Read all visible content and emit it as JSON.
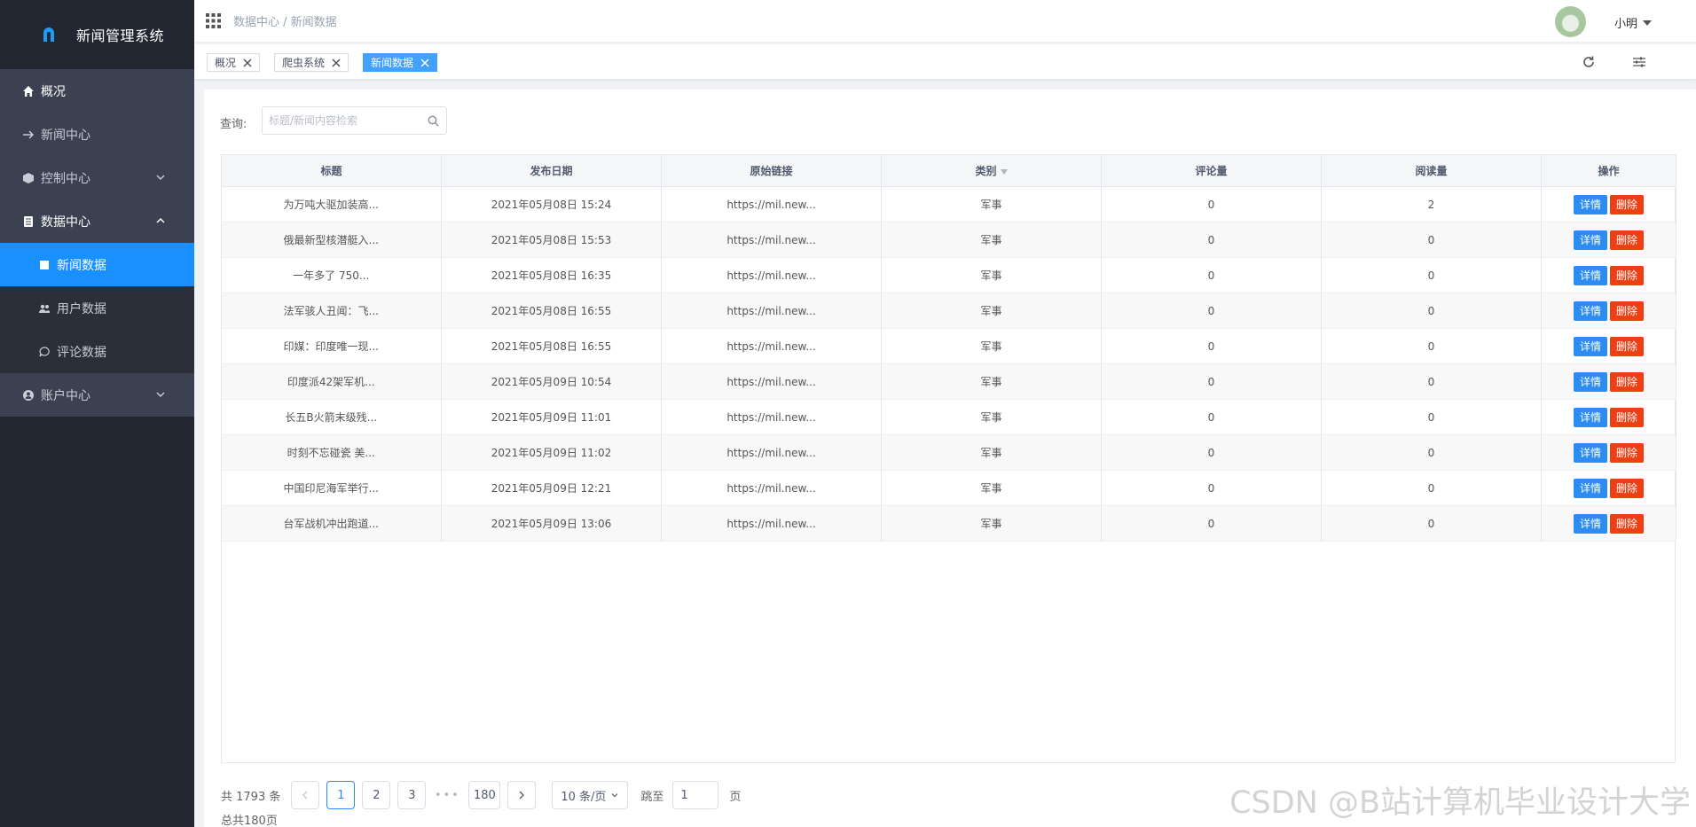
{
  "app": {
    "title": "新闻管理系统"
  },
  "sidebar": {
    "items": [
      {
        "label": "概况",
        "icon": "home-icon"
      },
      {
        "label": "新闻中心",
        "icon": "arrow-right-icon"
      },
      {
        "label": "控制中心",
        "icon": "cube-icon"
      },
      {
        "label": "数据中心",
        "icon": "database-icon"
      },
      {
        "label": "新闻数据",
        "icon": "square-icon"
      },
      {
        "label": "用户数据",
        "icon": "users-icon"
      },
      {
        "label": "评论数据",
        "icon": "comment-icon"
      },
      {
        "label": "账户中心",
        "icon": "user-circle-icon"
      }
    ]
  },
  "header": {
    "breadcrumb": "数据中心 / 新闻数据",
    "username": "小明"
  },
  "tags": [
    "概况",
    "爬虫系统",
    "新闻数据"
  ],
  "search": {
    "label": "查询:",
    "placeholder": "标题/新闻内容检索"
  },
  "table": {
    "columns": [
      "标题",
      "发布日期",
      "原始链接",
      "类别",
      "评论量",
      "阅读量",
      "操作"
    ],
    "rows": [
      [
        "为万吨大驱加装高...",
        "2021年05月08日 15:24",
        "https://mil.new...",
        "军事",
        "0",
        "2"
      ],
      [
        "俄最新型核潜艇入...",
        "2021年05月08日 15:53",
        "https://mil.new...",
        "军事",
        "0",
        "0"
      ],
      [
        "一年多了 750...",
        "2021年05月08日 16:35",
        "https://mil.new...",
        "军事",
        "0",
        "0"
      ],
      [
        "法军骇人丑闻：飞...",
        "2021年05月08日 16:55",
        "https://mil.new...",
        "军事",
        "0",
        "0"
      ],
      [
        "印媒：印度唯一现...",
        "2021年05月08日 16:55",
        "https://mil.new...",
        "军事",
        "0",
        "0"
      ],
      [
        "印度派42架军机...",
        "2021年05月09日 10:54",
        "https://mil.new...",
        "军事",
        "0",
        "0"
      ],
      [
        "长五B火箭末级残...",
        "2021年05月09日 11:01",
        "https://mil.new...",
        "军事",
        "0",
        "0"
      ],
      [
        "时刻不忘碰瓷 美...",
        "2021年05月09日 11:02",
        "https://mil.new...",
        "军事",
        "0",
        "0"
      ],
      [
        "中国印尼海军举行...",
        "2021年05月09日 12:21",
        "https://mil.new...",
        "军事",
        "0",
        "0"
      ],
      [
        "台军战机冲出跑道...",
        "2021年05月09日 13:06",
        "https://mil.new...",
        "军事",
        "0",
        "0"
      ]
    ],
    "action_detail": "详情",
    "action_delete": "删除"
  },
  "pagination": {
    "total_text": "共 1793 条",
    "pages": [
      "1",
      "2",
      "3",
      "180"
    ],
    "current": "1",
    "ellipsis": "•••",
    "page_size": "10 条/页",
    "jump_label": "跳至",
    "jump_value": "1",
    "jump_suffix": "页",
    "total_pages_text": "总共180页"
  },
  "watermark": "CSDN @B站计算机毕业设计大学",
  "colors": {
    "sidebar_bg": "#222630",
    "active": "#1890ff",
    "primary": "#2d8cf0",
    "danger": "#ed3f14"
  }
}
